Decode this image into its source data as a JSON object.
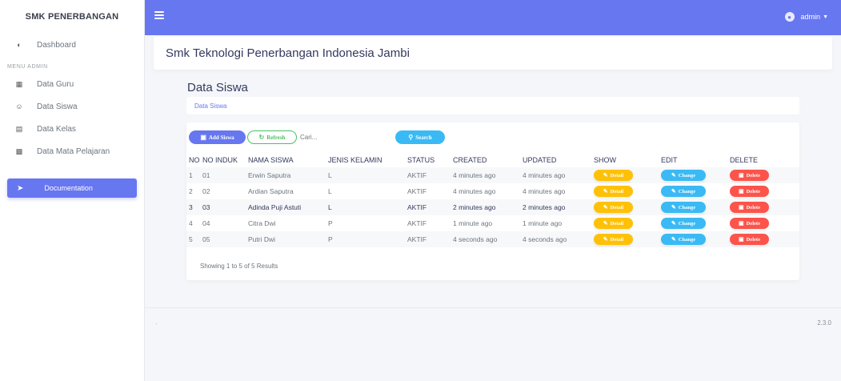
{
  "sidebar": {
    "brand": "SMK PENERBANGAN",
    "dashboard": "Dashboard",
    "section_label": "MENU ADMIN",
    "items": [
      {
        "label": "Data Guru",
        "icon": "id-card-icon"
      },
      {
        "label": "Data Siswa",
        "icon": "user-icon"
      },
      {
        "label": "Data Kelas",
        "icon": "school-icon"
      },
      {
        "label": "Data Mata Pelajaran",
        "icon": "book-icon"
      }
    ],
    "doc_label": "Documentation"
  },
  "topbar": {
    "user": "admin"
  },
  "header": {
    "title": "Smk Teknologi Penerbangan Indonesia Jambi"
  },
  "section": {
    "title": "Data Siswa",
    "breadcrumb": "Data Siswa"
  },
  "toolbar": {
    "add_label": "Add Siswa",
    "refresh_label": "Refresh",
    "search_placeholder": "Cari...",
    "search_label": "Search"
  },
  "table": {
    "headers": {
      "no": "NO",
      "induk": "NO INDUK",
      "nama": "NAMA SISWA",
      "jk": "JENIS KELAMIN",
      "status": "STATUS",
      "created": "CREATED",
      "updated": "UPDATED",
      "show": "SHOW",
      "edit": "EDIT",
      "delete": "DELETE"
    },
    "rows": [
      {
        "no": "1",
        "induk": "01",
        "nama": "Erwin Saputra",
        "jk": "L",
        "status": "AKTIF",
        "created": "4 minutes ago",
        "updated": "4 minutes ago"
      },
      {
        "no": "2",
        "induk": "02",
        "nama": "Ardian Saputra",
        "jk": "L",
        "status": "AKTIF",
        "created": "4 minutes ago",
        "updated": "4 minutes ago"
      },
      {
        "no": "3",
        "induk": "03",
        "nama": "Adinda Puji Astuti",
        "jk": "L",
        "status": "AKTIF",
        "created": "2 minutes ago",
        "updated": "2 minutes ago"
      },
      {
        "no": "4",
        "induk": "04",
        "nama": "Citra Dwi",
        "jk": "P",
        "status": "AKTIF",
        "created": "1 minute ago",
        "updated": "1 minute ago"
      },
      {
        "no": "5",
        "induk": "05",
        "nama": "Putri Dwi",
        "jk": "P",
        "status": "AKTIF",
        "created": "4 seconds ago",
        "updated": "4 seconds ago"
      }
    ],
    "detail_label": "Detail",
    "change_label": "Change",
    "delete_label": "Delete",
    "results": "Showing 1 to 5 of 5 Results"
  },
  "footer": {
    "left": "·",
    "version": "2.3.0"
  },
  "colors": {
    "primary": "#6777ef",
    "success": "#47c363",
    "info": "#3abaf4",
    "warning": "#ffc107",
    "danger": "#fc544b"
  }
}
